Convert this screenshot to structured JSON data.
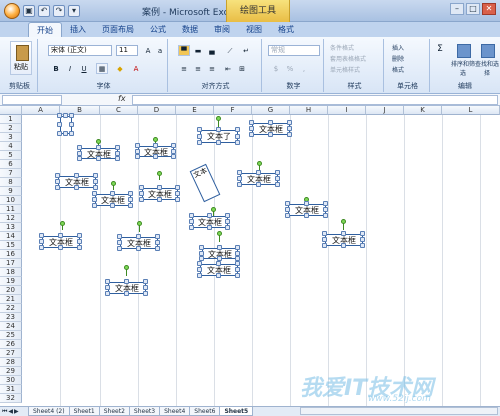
{
  "window": {
    "title": "案例 - Microsoft Excel",
    "contextual_title": "绘图工具"
  },
  "tabs": [
    "开始",
    "插入",
    "页面布局",
    "公式",
    "数据",
    "审阅",
    "视图",
    "格式"
  ],
  "ribbon": {
    "clipboard": {
      "paste": "粘贴",
      "label": "剪贴板"
    },
    "font": {
      "name": "宋体 (正文)",
      "size": "11",
      "label": "字体",
      "bold": "B",
      "italic": "I",
      "underline": "U"
    },
    "alignment": {
      "label": "对齐方式"
    },
    "number": {
      "format": "常规",
      "percent": "%",
      "label": "数字"
    },
    "styles": {
      "cond": "条件格式",
      "table": "套用表格格式",
      "cell": "单元格样式",
      "label": "样式"
    },
    "cells": {
      "insert": "插入",
      "delete": "删除",
      "format": "格式",
      "label": "单元格"
    },
    "editing": {
      "sort": "排序和筛选",
      "find": "查找和选择",
      "label": "编辑"
    }
  },
  "formula_bar": {
    "fx": "fx"
  },
  "columns": [
    "A",
    "B",
    "C",
    "D",
    "E",
    "F",
    "G",
    "H",
    "I",
    "J",
    "K",
    "L"
  ],
  "rows": [
    "1",
    "2",
    "3",
    "4",
    "5",
    "6",
    "7",
    "8",
    "9",
    "10",
    "11",
    "12",
    "13",
    "14",
    "15",
    "16",
    "17",
    "18",
    "19",
    "20",
    "21",
    "22",
    "23",
    "24",
    "25",
    "26",
    "27",
    "28",
    "29",
    "30",
    "31",
    "32"
  ],
  "textboxes": [
    "文本框",
    "文本框",
    "文本了",
    "文本框",
    "文本框",
    "文本框",
    "文本框",
    "文本框",
    "文本",
    "文本框",
    "文本框",
    "文本框",
    "文本框",
    "文本框",
    "文本框",
    "文本框"
  ],
  "sheets": [
    "Sheet4 (2)",
    "Sheet1",
    "Sheet2",
    "Sheet3",
    "Sheet4",
    "Sheet6",
    "Sheet5"
  ],
  "active_sheet": "Sheet5",
  "watermark": {
    "main": "我爱IT技术网",
    "sub": "www.52ij.com"
  }
}
